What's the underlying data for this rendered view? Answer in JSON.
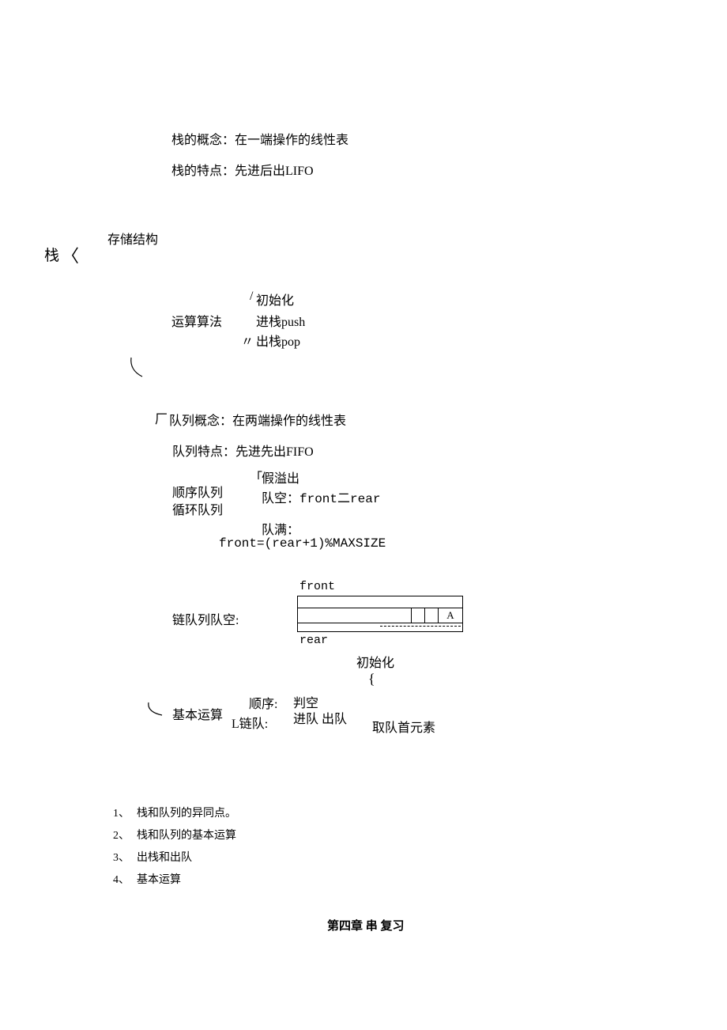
{
  "stack": {
    "root": "栈",
    "angle": "〈",
    "concept": "栈的概念：在一端操作的线性表",
    "feature": "栈的特点：先进后出LIFO",
    "storage": "存储结构",
    "algo_label": "运算算法",
    "slash": "/",
    "init": "初始化",
    "push": "进栈push",
    "quote": "〃",
    "pop": "出栈pop"
  },
  "queue": {
    "factory": "厂",
    "concept": "队列概念：在两端操作的线性表",
    "feature": "队列特点：先进先出FIFO",
    "seq_label": "顺序队列",
    "circ_label": "循环队列",
    "bracket_top": "「",
    "fake_overflow": "假溢出",
    "empty": "队空：front二rear",
    "full_label": "队满：",
    "full_formula": "front=(rear+1)%MAXSIZE",
    "link_empty_label": "链队列队空:",
    "front_label": "front",
    "rear_label": "rear",
    "cell_a": "A",
    "init": "初始化",
    "brace_small": "{",
    "ops_label": "基本运算",
    "seq_sub": "顺序:",
    "link_sub": "L链队:",
    "judge_empty": "判空",
    "enq_deq": "进队 出队",
    "get_front": "取队首元素"
  },
  "list_items": [
    {
      "num": "1、",
      "text": "栈和队列的异同点。"
    },
    {
      "num": "2、",
      "text": "栈和队列的基本运算"
    },
    {
      "num": "3、",
      "text": "出栈和出队"
    },
    {
      "num": "4、",
      "text": "基本运算"
    }
  ],
  "chapter_title": "第四章 串 复习"
}
